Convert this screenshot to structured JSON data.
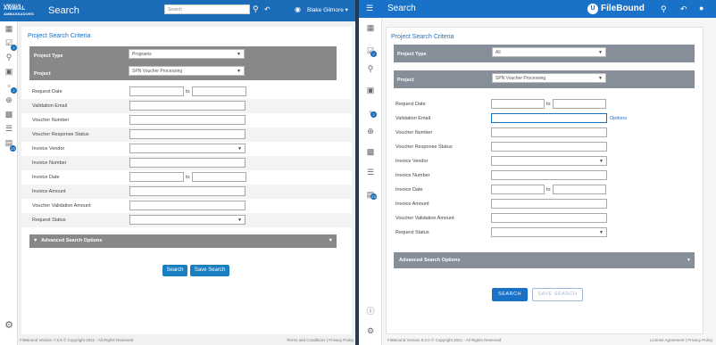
{
  "left": {
    "logo_lines": [
      "LINCOLN",
      "ANIMAL",
      "AMBASSADORS"
    ],
    "header_title": "Search",
    "search_placeholder": "Search",
    "user_name": "Blake Gilmore",
    "section_title": "Project Search Criteria",
    "project_type_label": "Project Type",
    "project_type_value": "Programs",
    "project_label": "Project",
    "project_value": "SPN Voucher Processing",
    "fields": [
      {
        "label": "Request Date",
        "kind": "range"
      },
      {
        "label": "Validation Email",
        "kind": "text"
      },
      {
        "label": "Voucher Number",
        "kind": "text"
      },
      {
        "label": "Voucher Response Status",
        "kind": "text"
      },
      {
        "label": "Invoice Vendor",
        "kind": "select"
      },
      {
        "label": "Invoice Number",
        "kind": "text"
      },
      {
        "label": "Invoice Date",
        "kind": "range"
      },
      {
        "label": "Invoice Amount",
        "kind": "text"
      },
      {
        "label": "Voucher Validation Amount",
        "kind": "text"
      },
      {
        "label": "Request Status",
        "kind": "select"
      }
    ],
    "to_label": "to",
    "advanced_label": "Advanced Search Options",
    "search_button": "Search",
    "save_search_button": "Save Search",
    "footer_left": "FileBound Version 7.5.5 © Copyright 2021 - All Rights Reserved",
    "footer_right": "Terms and Conditions | Privacy Policy",
    "sidebar_badges": [
      "2",
      "2",
      "23"
    ]
  },
  "right": {
    "header_title": "Search",
    "brand": "FileBound",
    "section_title": "Project Search Criteria",
    "project_type_label": "Project Type",
    "project_type_value": "All",
    "project_label": "Project",
    "project_value": "SPN Voucher Processing",
    "fields": [
      {
        "label": "Request Date",
        "kind": "range"
      },
      {
        "label": "Validation Email",
        "kind": "text",
        "extra": "Options"
      },
      {
        "label": "Voucher Number",
        "kind": "text"
      },
      {
        "label": "Voucher Response Status",
        "kind": "text"
      },
      {
        "label": "Invoice Vendor",
        "kind": "select"
      },
      {
        "label": "Invoice Number",
        "kind": "text"
      },
      {
        "label": "Invoice Date",
        "kind": "range"
      },
      {
        "label": "Invoice Amount",
        "kind": "text"
      },
      {
        "label": "Voucher Validation Amount",
        "kind": "text"
      },
      {
        "label": "Request Status",
        "kind": "select"
      }
    ],
    "to_label": "to",
    "advanced_label": "Advanced Search Options",
    "search_button": "SEARCH",
    "save_search_button": "SAVE SEARCH",
    "footer_left": "FileBound Version 8.0.0 © Copyright 2021 - All Rights Reserved",
    "footer_right": "License Agreement | Privacy Policy",
    "sidebar_badges": [
      "2",
      "2",
      "23"
    ]
  },
  "colors": {
    "left_header": "#1a6bb8",
    "right_header": "#1a72c8",
    "gray_band": "#888888",
    "button": "#1a7fc1"
  }
}
